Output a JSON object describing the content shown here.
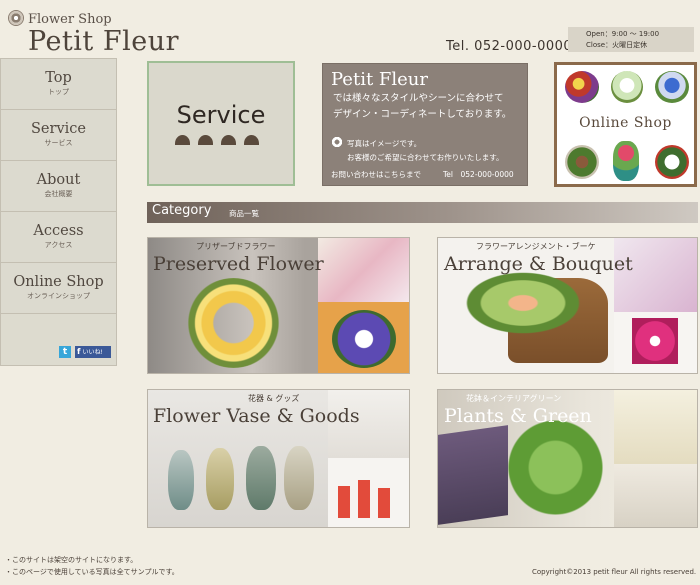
{
  "header": {
    "logo_small": "Flower Shop",
    "logo_big": "Petit Fleur",
    "tel": "Tel.  052-000-0000",
    "hours_open": "Open：9:00 ～ 19:00",
    "hours_close": "Close：火曜日定休"
  },
  "nav": [
    {
      "label": "Top",
      "sub": "トップ"
    },
    {
      "label": "Service",
      "sub": "サービス"
    },
    {
      "label": "About",
      "sub": "会社概要"
    },
    {
      "label": "Access",
      "sub": "アクセス"
    },
    {
      "label": "Online Shop",
      "sub": "オンラインショップ"
    }
  ],
  "social": {
    "twitter": "t",
    "facebook_f": "f",
    "facebook_like": "いいね!"
  },
  "service": {
    "title": "Service"
  },
  "info": {
    "title": "Petit Fleur",
    "line1": "では様々なスタイルやシーンに合わせて",
    "line2": "デザイン・コーディネートしております。",
    "note1": "写真はイメージです。",
    "note2": "お客様のご希望に合わせてお作りいたします。",
    "contact_label": "お問い合わせはこちらまで",
    "contact_tel": "Tel　052-000-0000"
  },
  "shop": {
    "title": "Online Shop"
  },
  "category": {
    "title": "Category",
    "subtitle": "商品一覧"
  },
  "tiles": [
    {
      "jp": "プリザーブドフラワー",
      "en": "Preserved Flower"
    },
    {
      "jp": "フラワーアレンジメント・ブーケ",
      "en": "Arrange & Bouquet"
    },
    {
      "jp": "花器 & グッズ",
      "en": "Flower Vase & Goods"
    },
    {
      "jp": "花鉢＆インテリアグリーン",
      "en": "Plants & Green"
    }
  ],
  "footer": {
    "note1": "・このサイトは架空のサイトになります。",
    "note2": "・このページで使用している写真は全てサンプルです。",
    "copyright": "Copyright©2013 petit fleur All rights reserved."
  }
}
